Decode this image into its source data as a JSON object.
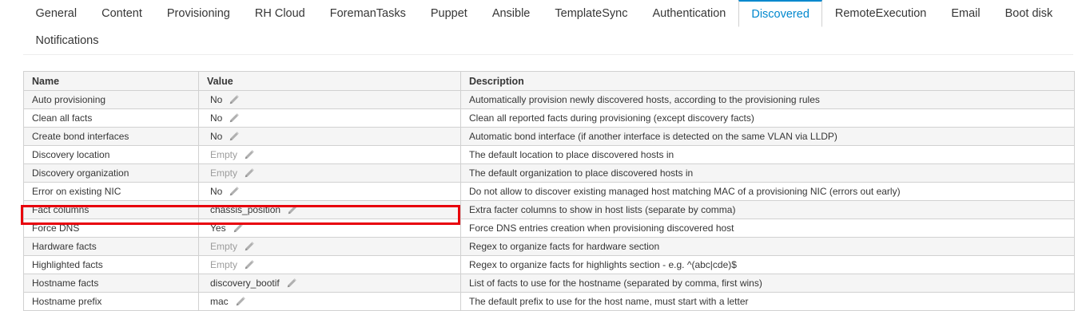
{
  "tabs": [
    {
      "label": "General",
      "active": false
    },
    {
      "label": "Content",
      "active": false
    },
    {
      "label": "Provisioning",
      "active": false
    },
    {
      "label": "RH Cloud",
      "active": false
    },
    {
      "label": "ForemanTasks",
      "active": false
    },
    {
      "label": "Puppet",
      "active": false
    },
    {
      "label": "Ansible",
      "active": false
    },
    {
      "label": "TemplateSync",
      "active": false
    },
    {
      "label": "Authentication",
      "active": false
    },
    {
      "label": "Discovered",
      "active": true
    },
    {
      "label": "RemoteExecution",
      "active": false
    },
    {
      "label": "Email",
      "active": false
    },
    {
      "label": "Boot disk",
      "active": false
    },
    {
      "label": "Notifications",
      "active": false
    }
  ],
  "table": {
    "headers": {
      "name": "Name",
      "value": "Value",
      "description": "Description"
    },
    "rows": [
      {
        "name": "Auto provisioning",
        "value": "No",
        "empty": false,
        "description": "Automatically provision newly discovered hosts, according to the provisioning rules"
      },
      {
        "name": "Clean all facts",
        "value": "No",
        "empty": false,
        "description": "Clean all reported facts during provisioning (except discovery facts)"
      },
      {
        "name": "Create bond interfaces",
        "value": "No",
        "empty": false,
        "description": "Automatic bond interface (if another interface is detected on the same VLAN via LLDP)"
      },
      {
        "name": "Discovery location",
        "value": "Empty",
        "empty": true,
        "description": "The default location to place discovered hosts in"
      },
      {
        "name": "Discovery organization",
        "value": "Empty",
        "empty": true,
        "description": "The default organization to place discovered hosts in"
      },
      {
        "name": "Error on existing NIC",
        "value": "No",
        "empty": false,
        "description": "Do not allow to discover existing managed host matching MAC of a provisioning NIC (errors out early)"
      },
      {
        "name": "Fact columns",
        "value": "chassis_position",
        "empty": false,
        "highlighted": true,
        "description": "Extra facter columns to show in host lists (separate by comma)"
      },
      {
        "name": "Force DNS",
        "value": "Yes",
        "empty": false,
        "description": "Force DNS entries creation when provisioning discovered host"
      },
      {
        "name": "Hardware facts",
        "value": "Empty",
        "empty": true,
        "description": "Regex to organize facts for hardware section"
      },
      {
        "name": "Highlighted facts",
        "value": "Empty",
        "empty": true,
        "description": "Regex to organize facts for highlights section - e.g. ^(abc|cde)$"
      },
      {
        "name": "Hostname facts",
        "value": "discovery_bootif",
        "empty": false,
        "description": "List of facts to use for the hostname (separated by comma, first wins)"
      },
      {
        "name": "Hostname prefix",
        "value": "mac",
        "empty": false,
        "description": "The default prefix to use for the host name, must start with a letter"
      }
    ]
  },
  "colors": {
    "accent": "#0088ce",
    "highlight": "#e8000b"
  },
  "icons": {
    "edit": "pencil-icon"
  }
}
